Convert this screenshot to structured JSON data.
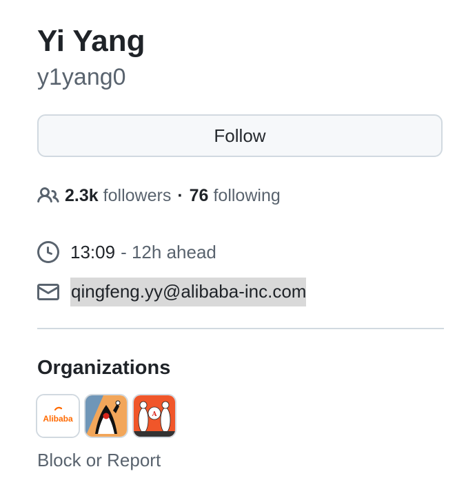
{
  "profile": {
    "full_name": "Yi Yang",
    "username": "y1yang0",
    "follow_label": "Follow",
    "followers_count": "2.3k",
    "followers_label": "followers",
    "separator": "·",
    "following_count": "76",
    "following_label": "following",
    "local_time": "13:09",
    "time_offset": "- 12h ahead",
    "email": "qingfeng.yy@alibaba-inc.com",
    "icons": {
      "people": "people-icon",
      "clock": "clock-icon",
      "mail": "mail-icon"
    }
  },
  "organizations": {
    "heading": "Organizations",
    "items": [
      {
        "name": "alibaba",
        "logo_text": "Alibaba",
        "icon": "alibaba-logo",
        "color": "#ff6a00"
      },
      {
        "name": "openjdk-duke",
        "icon": "duke-mascot-logo",
        "color": "#6f96b8"
      },
      {
        "name": "orange-woodcut",
        "icon": "woodcut-figures-logo",
        "color": "#f0562a"
      }
    ]
  },
  "block_report_label": "Block or Report",
  "colors": {
    "text_primary": "#1f2328",
    "text_muted": "#59636e",
    "border": "#d1d9e0",
    "button_bg": "#f6f8fa",
    "selection_bg": "#d9d9d9"
  }
}
